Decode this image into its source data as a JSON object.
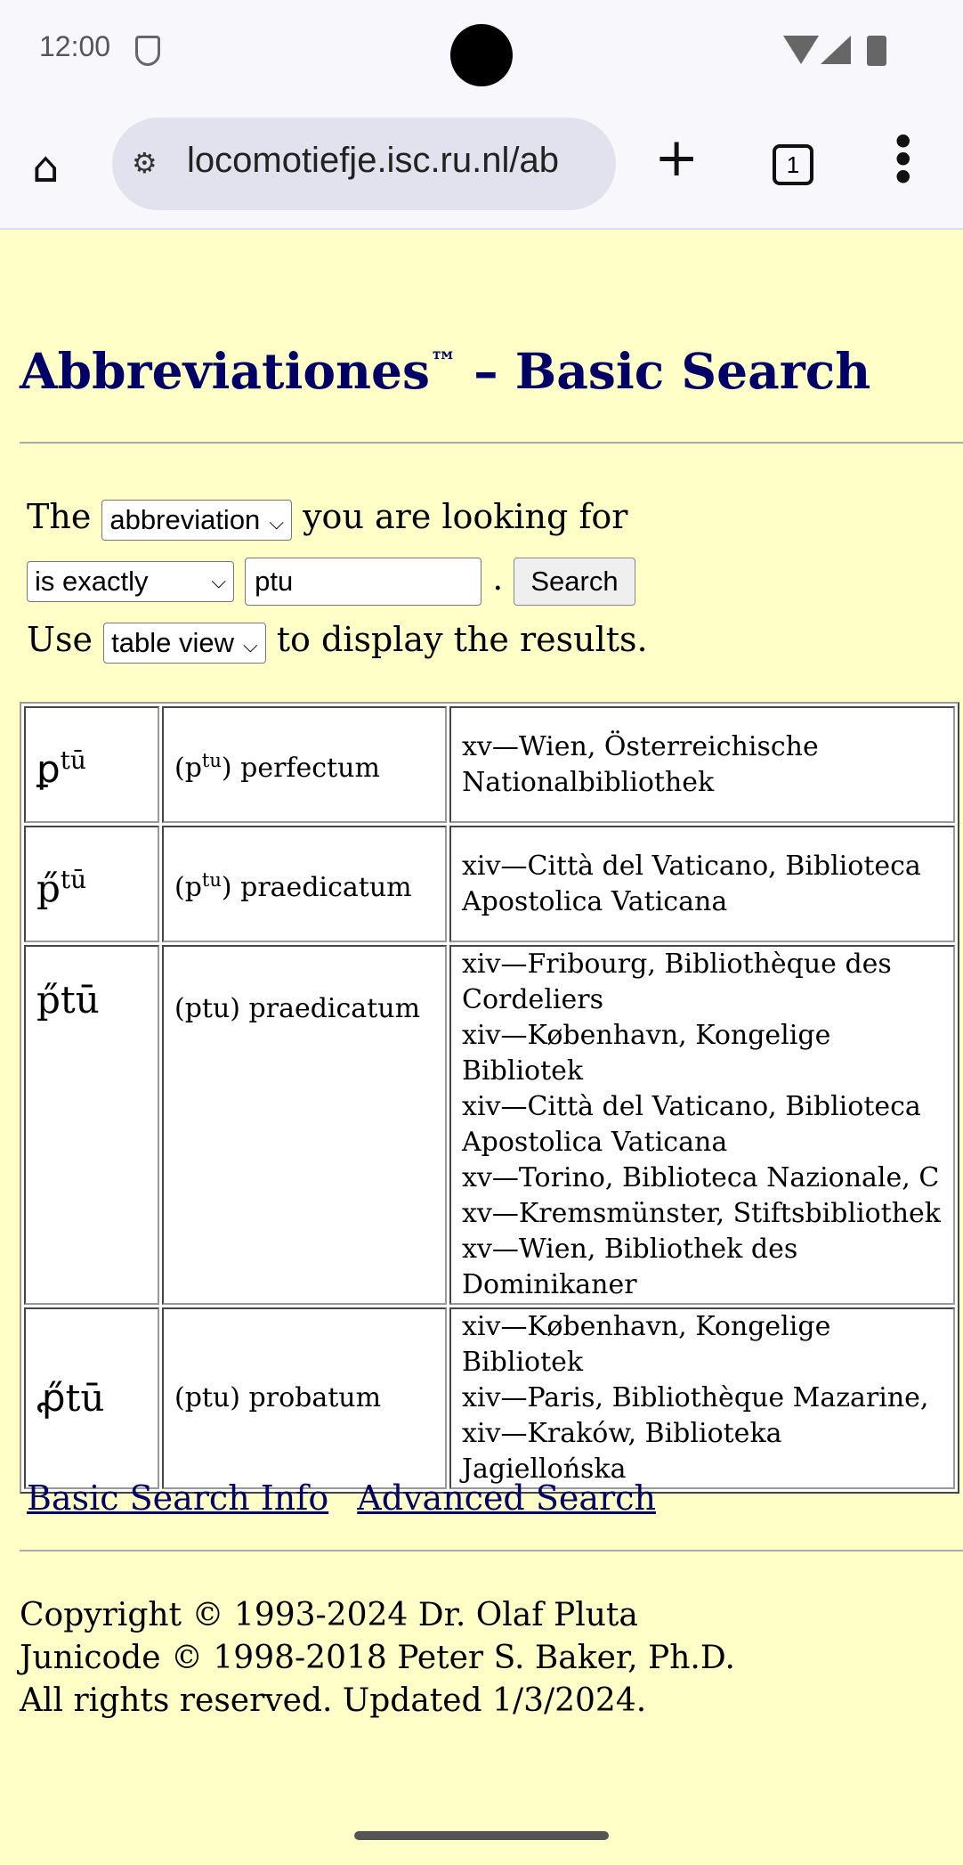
{
  "status_bar": {
    "time": "12:00"
  },
  "browser": {
    "url": "locomotiefje.isc.ru.nl/ab",
    "tab_count": "1"
  },
  "page": {
    "title": "Abbreviationes",
    "title_mark": "™",
    "title_rest": " – Basic Search",
    "form": {
      "the": "The",
      "field_select": "abbreviation",
      "looking_for": "you are looking for",
      "match_select": "is exactly",
      "query": "ptu",
      "period": ".",
      "search_button": "Search",
      "use": "Use",
      "view_select": "table view",
      "display": "to display the results."
    },
    "results": [
      {
        "abbr": "ꝑ",
        "abbr_sup": "tū",
        "expansion_pre": "(p",
        "expansion_sup": "tu",
        "expansion_post": ") perfectum",
        "sources": [
          "xv—Wien, Österreichische Nationalbibliothek"
        ]
      },
      {
        "abbr": "p̋",
        "abbr_sup": "tū",
        "expansion_pre": "(p",
        "expansion_sup": "tu",
        "expansion_post": ") praedicatum",
        "sources": [
          "xiv—Città del Vaticano, Biblioteca Apostolica Vaticana"
        ]
      },
      {
        "abbr": "p̋tū",
        "expansion": "(ptu) praedicatum",
        "sources": [
          "xiv—Fribourg, Bibliothèque des Cordeliers",
          "xiv—København, Kongelige Bibliotek",
          "xiv—Città del Vaticano, Biblioteca Apostolica Vaticana",
          "xv—Torino, Biblioteca Nazionale, C",
          "xv—Kremsmünster, Stiftsbibliothek",
          "xv—Wien, Bibliothek des Dominikaner"
        ]
      },
      {
        "abbr": "ꝓ̋tū",
        "expansion": "(ptu) probatum",
        "sources": [
          "xiv—København, Kongelige Bibliotek",
          "xiv—Paris, Bibliothèque Mazarine,",
          "xiv—Kraków, Biblioteka Jagiellońska"
        ]
      }
    ],
    "links": {
      "info": "Basic Search Info",
      "advanced": "Advanced Search"
    },
    "footer": [
      "Copyright © 1993-2024 Dr. Olaf Pluta",
      "Junicode © 1998-2018 Peter S. Baker, Ph.D.",
      "All rights reserved. Updated 1/3/2024."
    ]
  }
}
